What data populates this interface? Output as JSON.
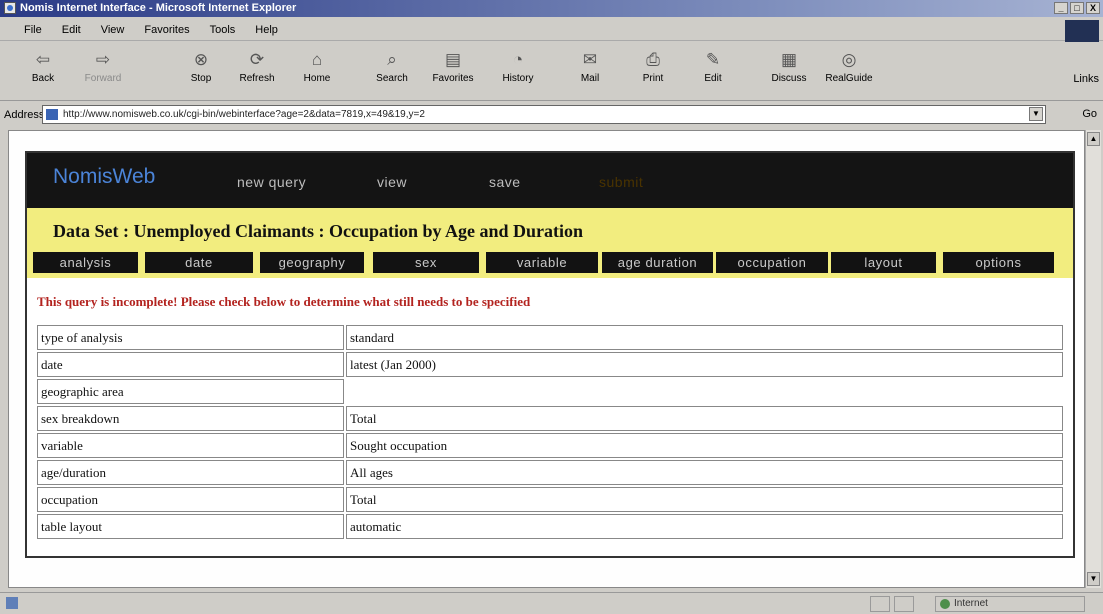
{
  "window": {
    "title": "Nomis Internet Interface - Microsoft Internet Explorer",
    "controls": [
      "_",
      "□",
      "X"
    ]
  },
  "menu": [
    "File",
    "Edit",
    "View",
    "Favorites",
    "Tools",
    "Help"
  ],
  "toolbar": {
    "buttons": [
      {
        "label": "Back",
        "icon": "back-arrow-icon",
        "glyph": "⇦"
      },
      {
        "label": "Forward",
        "icon": "forward-arrow-icon",
        "glyph": "⇨"
      },
      {
        "label": "Stop",
        "icon": "stop-icon",
        "glyph": "⊗"
      },
      {
        "label": "Refresh",
        "icon": "refresh-icon",
        "glyph": "⟳"
      },
      {
        "label": "Home",
        "icon": "home-icon",
        "glyph": "⌂"
      },
      {
        "label": "Search",
        "icon": "search-icon",
        "glyph": "⌕"
      },
      {
        "label": "Favorites",
        "icon": "favorites-icon",
        "glyph": "▤"
      },
      {
        "label": "History",
        "icon": "history-icon",
        "glyph": "◔"
      },
      {
        "label": "Mail",
        "icon": "mail-icon",
        "glyph": "✉"
      },
      {
        "label": "Print",
        "icon": "print-icon",
        "glyph": "⎙"
      },
      {
        "label": "Edit",
        "icon": "edit-icon",
        "glyph": "✎"
      },
      {
        "label": "Discuss",
        "icon": "discuss-icon",
        "glyph": "▦"
      },
      {
        "label": "RealGuide",
        "icon": "realguide-icon",
        "glyph": "◎"
      }
    ],
    "links_label": "Links"
  },
  "address": {
    "label": "Address",
    "url": "http://www.nomisweb.co.uk/cgi-bin/webinterface?age=2&data=7819,x=49&19,y=2",
    "go_label": "Go"
  },
  "nomis": {
    "logo": "NomisWeb",
    "nav": [
      "new query",
      "view",
      "save",
      "submit"
    ],
    "dataset_title": "Data Set : Unemployed Claimants : Occupation by Age and Duration",
    "tabs": [
      "analysis",
      "date",
      "geography",
      "sex",
      "variable",
      "age duration",
      "occupation",
      "layout",
      "options"
    ],
    "warning": "This query is incomplete! Please check below to determine what still needs to be specified",
    "rows": [
      {
        "label": "type of analysis",
        "value": "standard"
      },
      {
        "label": "date",
        "value": "latest (Jan 2000)"
      },
      {
        "label": "geographic area",
        "value": ""
      },
      {
        "label": "sex breakdown",
        "value": "Total"
      },
      {
        "label": "variable",
        "value": "Sought occupation"
      },
      {
        "label": "age/duration",
        "value": "All ages"
      },
      {
        "label": "occupation",
        "value": "Total"
      },
      {
        "label": "table layout",
        "value": "automatic"
      }
    ]
  },
  "status": {
    "zone": "Internet"
  },
  "colors": {
    "header_bg": "#141414",
    "logo": "#4b84d8",
    "dataset_bar": "#f2ed7f",
    "warning": "#b3231f"
  }
}
